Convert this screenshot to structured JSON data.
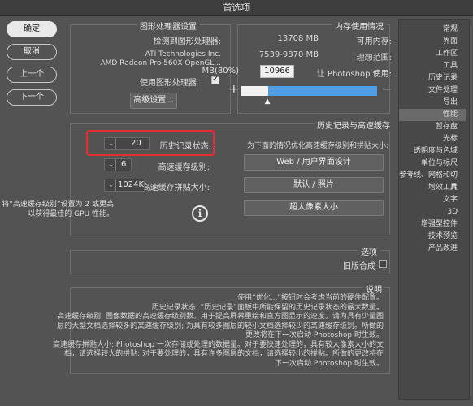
{
  "window": {
    "title": "首选项"
  },
  "buttons": {
    "ok": "确定",
    "cancel": "取消",
    "prev": "上一个",
    "next": "下一个"
  },
  "sidebar": {
    "items": [
      "常规",
      "界面",
      "工作区",
      "工具",
      "历史记录",
      "文件处理",
      "导出",
      "性能",
      "暂存盘",
      "光标",
      "透明度与色域",
      "单位与标尺",
      "参考线、网格和切片",
      "增效工具",
      "文字",
      "3D",
      "增强型控件",
      "技术预览",
      "产品改进"
    ],
    "selected_index": 7
  },
  "memory": {
    "legend": "内存使用情况",
    "available_label": "可用内存:",
    "available_value": "13708 MB",
    "ideal_label": "理想范围:",
    "ideal_value": "7539-9870 MB",
    "let_label": "让 Photoshop 使用:",
    "let_value": "10966",
    "let_unit": "MB(80%)",
    "minus": "−",
    "plus": "+",
    "slider_fraction": 0.8
  },
  "gpu": {
    "legend": "图形处理器设置",
    "detected_label": "检测到图形处理器:",
    "detected_line1": "ATI Technologies Inc.",
    "detected_line2": "AMD Radeon Pro 560X OpenGL...",
    "use_gpu_label": "使用图形处理器",
    "use_gpu_checked": true,
    "advanced_button": "高级设置..."
  },
  "history": {
    "legend": "历史记录与高速缓存",
    "optimize_label": "为下面的情况优化高速缓存级别和拼贴大小:",
    "btn_web": "Web / 用户界面设计",
    "btn_default": "默认 / 照片",
    "btn_large": "超大像素大小",
    "states_label": "历史记录状态:",
    "states_value": "20",
    "cache_levels_label": "高速缓存级别:",
    "cache_levels_value": "6",
    "tile_size_label": "高速缓存拼贴大小:",
    "tile_size_value": "1024K",
    "note_line1": "将“高速缓存级别”设置为 2 或更高",
    "note_line2": "以获得最佳的 GPU 性能。"
  },
  "options": {
    "legend": "选项",
    "legacy_label": "旧版合成",
    "legacy_checked": false
  },
  "description": {
    "legend": "说明",
    "lines": [
      "使用“优化...”按钮时会考虑当前的硬件配置。",
      "历史记录状态: “历史记录”面板中所能保留的历史记录状态的最大数量。",
      "高速缓存级别: 图像数据的高速缓存级别数。用于提高屏幕重绘和直方图显示的速度。请为具有少量图",
      "层的大型文档选择较多的高速缓存级别; 为具有较多图层的较小文档选择较少的高速缓存级别。所做的",
      "更改将在下一次启动 Photoshop 时生效。",
      "高速缓存拼贴大小: Photoshop 一次存储或处理的数据量。对于要快速处理的，具有较大像素大小的文",
      "档，请选择较大的拼贴; 对于要处理的，具有许多图层的文档，请选择较小的拼贴。所做的更改将在",
      "下一次启动 Photoshop 时生效。"
    ]
  }
}
